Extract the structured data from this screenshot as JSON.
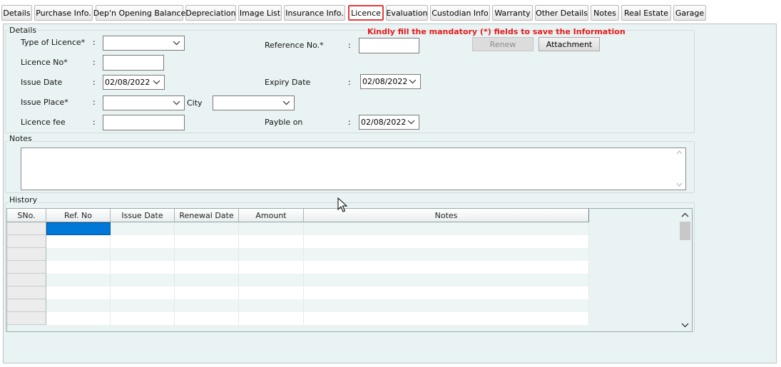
{
  "tabs": [
    {
      "label": "Details"
    },
    {
      "label": "Purchase Info."
    },
    {
      "label": "Dep'n Opening Balance"
    },
    {
      "label": "Depreciation"
    },
    {
      "label": "Image List"
    },
    {
      "label": "Insurance Info."
    },
    {
      "label": "Licence"
    },
    {
      "label": "Evaluation"
    },
    {
      "label": "Custodian Info"
    },
    {
      "label": "Warranty"
    },
    {
      "label": "Other Details"
    },
    {
      "label": "Notes"
    },
    {
      "label": "Real Estate"
    },
    {
      "label": "Garage"
    }
  ],
  "active_tab": "Licence",
  "mandatory_message": "Kindly fill the mandatory (*) fields to save the Information",
  "details": {
    "title": "Details",
    "colon": ":",
    "type_of_licence_label": "Type of Licence*",
    "licence_no_label": "Licence No*",
    "issue_date_label": "Issue Date",
    "issue_date_value": "02/08/2022",
    "issue_place_label": "Issue Place*",
    "city_label": "City",
    "licence_fee_label": "Licence fee",
    "reference_no_label": "Reference No.*",
    "expiry_date_label": "Expiry Date",
    "expiry_date_value": "02/08/2022",
    "payble_on_label": "Payble on",
    "payble_on_value": "02/08/2022",
    "renew_button": "Renew",
    "attachment_button": "Attachment"
  },
  "notes": {
    "title": "Notes"
  },
  "history": {
    "title": "History",
    "columns": [
      "SNo.",
      "Ref. No",
      "Issue Date",
      "Renewal Date",
      "Amount",
      "Notes"
    ]
  },
  "colors": {
    "panel_bg": "#eaf3f3",
    "active_tab_border": "#e23c3c",
    "message_red": "#e51b1b",
    "selected_cell": "#0078d7",
    "alt_row": "#edf4f4"
  }
}
